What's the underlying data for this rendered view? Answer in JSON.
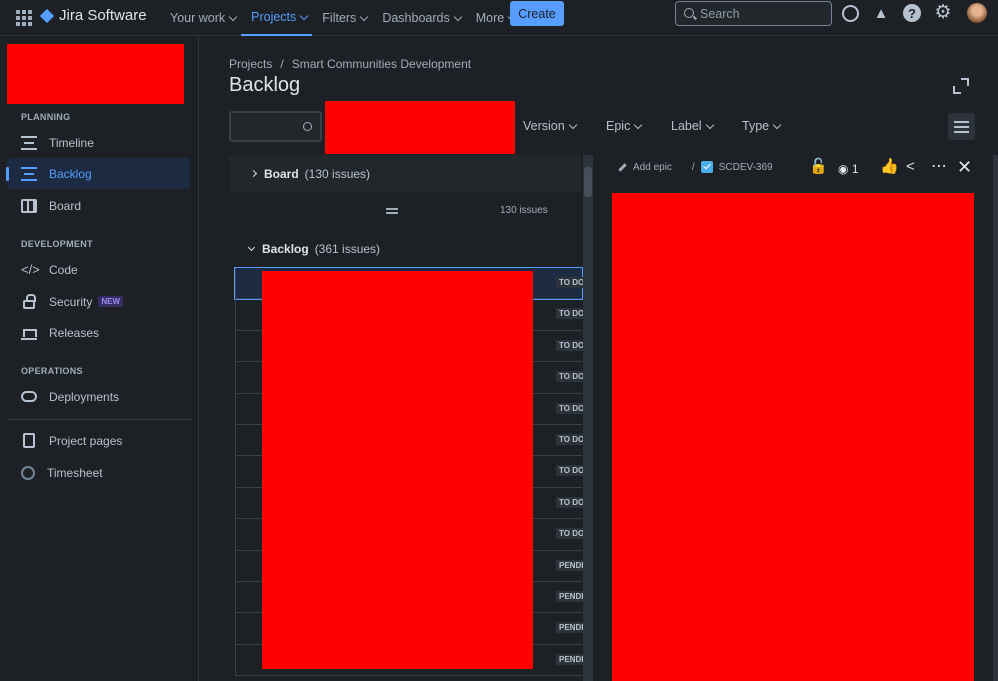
{
  "topbar": {
    "product": "Jira Software",
    "nav": [
      "Your work",
      "Projects",
      "Filters",
      "Dashboards",
      "More"
    ],
    "create_label": "Create",
    "search_placeholder": "Search"
  },
  "sidebar": {
    "planning_heading": "PLANNING",
    "planning": [
      "Timeline",
      "Backlog",
      "Board"
    ],
    "development_heading": "DEVELOPMENT",
    "development": [
      "Code",
      "Security",
      "Releases"
    ],
    "new_badge": "NEW",
    "operations_heading": "OPERATIONS",
    "operations": [
      "Deployments"
    ],
    "extras": [
      "Project pages",
      "Timesheet"
    ]
  },
  "main": {
    "breadcrumb": [
      "Projects",
      "/",
      "Smart Communities Development"
    ],
    "title": "Backlog",
    "filters": [
      "Version",
      "Epic",
      "Label",
      "Type"
    ],
    "board_label": "Board",
    "board_count": "(130 issues)",
    "board_issue_count": "130 issues",
    "backlog_label": "Backlog",
    "backlog_count": "(361 issues)",
    "rows": [
      {
        "status": "TO DO"
      },
      {
        "status": "TO DO"
      },
      {
        "status": "TO DO"
      },
      {
        "status": "TO DO"
      },
      {
        "status": "TO DO"
      },
      {
        "status": "TO DO"
      },
      {
        "status": "TO DO"
      },
      {
        "status": "TO DO"
      },
      {
        "status": "TO DO"
      },
      {
        "status": "PENDING"
      },
      {
        "status": "PENDING"
      },
      {
        "status": "PENDING"
      },
      {
        "status": "PENDING"
      }
    ]
  },
  "detail": {
    "add_epic": "Add epic",
    "separator": "/",
    "issue_key": "SCDEV-369",
    "watch_count": "1"
  },
  "colors": {
    "accent": "#579dff",
    "redaction": "#ff0000",
    "background": "#1d2125"
  }
}
